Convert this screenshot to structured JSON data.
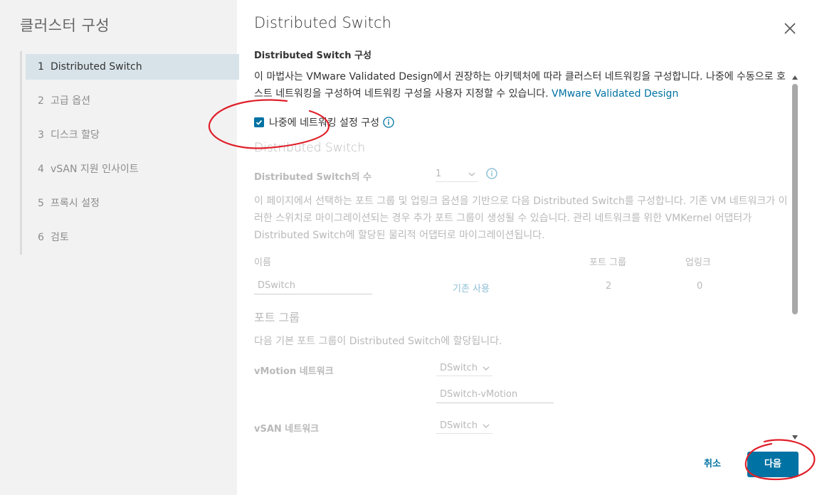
{
  "sidebar": {
    "title": "클러스터 구성",
    "steps": [
      {
        "num": "1",
        "label": "Distributed Switch"
      },
      {
        "num": "2",
        "label": "고급 옵션"
      },
      {
        "num": "3",
        "label": "디스크 할당"
      },
      {
        "num": "4",
        "label": "vSAN 지원 인사이트"
      },
      {
        "num": "5",
        "label": "프록시 설정"
      },
      {
        "num": "6",
        "label": "검토"
      }
    ]
  },
  "header": {
    "title": "Distributed Switch",
    "subtitle": "Distributed Switch 구성"
  },
  "main": {
    "description": "이 마법사는 VMware Validated Design에서 권장하는 아키텍처에 따라 클러스터 네트워킹을 구성합니다. 나중에 수동으로 호스트 네트워킹을 구성하여 네트워킹 구성을 사용자 지정할 수 있습니다. ",
    "description_link": "VMware Validated Design",
    "checkbox_label": "나중에 네트워킹 설정 구성",
    "checkbox_checked": true,
    "ds_heading": "Distributed Switch",
    "ds_count_label": "Distributed Switch의 수",
    "ds_count_value": "1",
    "ds_desc": "이 페이지에서 선택하는 포트 그룹 및 업링크 옵션을 기반으로 다음 Distributed Switch를 구성합니다. 기존 VM 네트워크가 이러한 스위치로 마이그레이션되는 경우 추가 포트 그룹이 생성될 수 있습니다. 관리 네트워크를 위한 VMKernel 어댑터가 Distributed Switch에 할당된 물리적 어댑터로 마이그레이션됩니다.",
    "table": {
      "col_name": "이름",
      "col_portgroup": "포트 그룹",
      "col_uplink": "업링크",
      "row": {
        "name": "DSwitch",
        "action": "기존 사용",
        "portgroups": "2",
        "uplinks": "0"
      }
    },
    "pg_heading": "포트 그룹",
    "pg_desc": "다음 기본 포트 그룹이 Distributed Switch에 할당됩니다.",
    "vmotion_label": "vMotion 네트워크",
    "vmotion_switch": "DSwitch",
    "vmotion_pg": "DSwitch-vMotion",
    "vsan_label": "vSAN 네트워크",
    "vsan_switch": "DSwitch"
  },
  "footer": {
    "cancel_label": "취소",
    "next_label": "다음"
  },
  "colors": {
    "accent": "#0072a3",
    "annotation": "#e0202a"
  }
}
